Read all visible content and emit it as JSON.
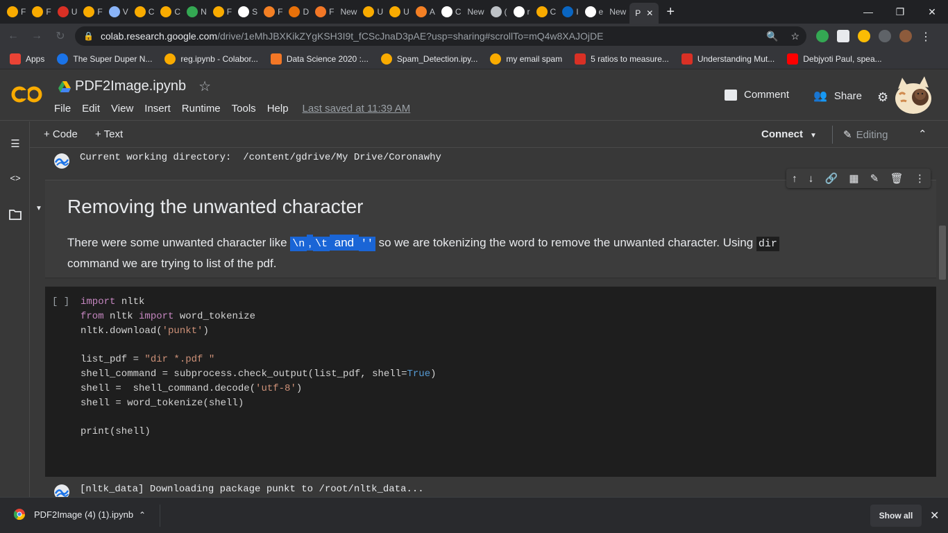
{
  "browser": {
    "tabs": [
      {
        "label": "F",
        "icon": "colab-icon",
        "color": "#f9ab00"
      },
      {
        "label": "F",
        "icon": "colab-icon",
        "color": "#f9ab00"
      },
      {
        "label": "U",
        "icon": "as-icon",
        "color": "#d93025"
      },
      {
        "label": "F",
        "icon": "colab-icon",
        "color": "#f9ab00"
      },
      {
        "label": "V",
        "icon": "shield-icon",
        "color": "#8ab4f8"
      },
      {
        "label": "C",
        "icon": "colab-icon",
        "color": "#f9ab00"
      },
      {
        "label": "C",
        "icon": "colab-icon",
        "color": "#f9ab00"
      },
      {
        "label": "N",
        "icon": "drive-icon",
        "color": "#34a853"
      },
      {
        "label": "F",
        "icon": "colab-icon",
        "color": "#f9ab00"
      },
      {
        "label": "S",
        "icon": "google-icon",
        "color": "#ffffff"
      },
      {
        "label": "F",
        "icon": "stackoverflow-icon",
        "color": "#f48024"
      },
      {
        "label": "D",
        "icon": "loading-icon",
        "color": "#e8710a"
      },
      {
        "label": "F",
        "icon": "jupyter-icon",
        "color": "#f37726"
      },
      {
        "label": "New",
        "icon": "none",
        "color": "#202124"
      },
      {
        "label": "U",
        "icon": "colab-icon",
        "color": "#f9ab00"
      },
      {
        "label": "U",
        "icon": "colab-icon",
        "color": "#f9ab00"
      },
      {
        "label": "A",
        "icon": "stackoverflow-icon",
        "color": "#f48024"
      },
      {
        "label": "C",
        "icon": "google-icon",
        "color": "#ffffff"
      },
      {
        "label": "New",
        "icon": "none",
        "color": "#202124"
      },
      {
        "label": "(",
        "icon": "audio-icon",
        "color": "#bdc1c6"
      },
      {
        "label": "r",
        "icon": "github-icon",
        "color": "#ffffff"
      },
      {
        "label": "C",
        "icon": "colab-icon",
        "color": "#f9ab00"
      },
      {
        "label": "I",
        "icon": "linkedin-icon",
        "color": "#0a66c2"
      },
      {
        "label": "e",
        "icon": "github-icon",
        "color": "#ffffff"
      },
      {
        "label": "New",
        "icon": "none",
        "color": "#202124"
      }
    ],
    "active_tab_label": "P",
    "close_symbol": "✕",
    "new_tab_symbol": "+",
    "window_controls": [
      "—",
      "❐",
      "✕"
    ],
    "url_domain": "colab.research.google.com",
    "url_path": "/drive/1eMhJBXKikZYgKSH3I9t_fCScJnaD3pAE?usp=sharing#scrollTo=mQ4w8XAJOjDE"
  },
  "bookmarks": [
    {
      "label": "Apps",
      "icon": "apps-grid-icon",
      "color": "#ea4335"
    },
    {
      "label": "The Super Duper N...",
      "icon": "globe-icon",
      "color": "#1a73e8"
    },
    {
      "label": "reg.ipynb - Colabor...",
      "icon": "colab-icon",
      "color": "#f9ab00"
    },
    {
      "label": "Data Science 2020 :...",
      "icon": "jupyter-icon",
      "color": "#f37726"
    },
    {
      "label": "Spam_Detection.ipy...",
      "icon": "colab-icon",
      "color": "#f9ab00"
    },
    {
      "label": "my email spam",
      "icon": "colab-icon",
      "color": "#f9ab00"
    },
    {
      "label": "5 ratios to measure...",
      "icon": "m-icon",
      "color": "#d93025"
    },
    {
      "label": "Understanding Mut...",
      "icon": "medium-icon",
      "color": "#d93025"
    },
    {
      "label": "Debjyoti Paul, spea...",
      "icon": "youtube-icon",
      "color": "#ff0000"
    }
  ],
  "colab": {
    "logo": "CO",
    "title": "PDF2Image.ipynb",
    "menu": [
      "File",
      "Edit",
      "View",
      "Insert",
      "Runtime",
      "Tools",
      "Help"
    ],
    "last_saved": "Last saved at 11:39 AM",
    "comment_label": "Comment",
    "share_label": "Share"
  },
  "toolbar": {
    "add_code": "+ Code",
    "add_text": "+ Text",
    "connect": "Connect",
    "editing": "Editing"
  },
  "notebook": {
    "cwd_output": "Current working directory:  /content/gdrive/My Drive/Coronawhy",
    "heading": "Removing the unwanted character",
    "para_before": "There were some unwanted character like ",
    "sel_newline": "\\n",
    "sel_comma": ",",
    "sel_tab": "\\t",
    "sel_and": " and ",
    "sel_quotes": "''",
    "para_middle": " so we are tokenizing the word to remove the unwanted character. Using ",
    "inline_code": "dir",
    "para_after": "command we are trying to list of the pdf.",
    "run_brackets": "[ ]",
    "nltk_output": "[nltk_data] Downloading package punkt to /root/nltk_data..."
  },
  "download": {
    "filename": "PDF2Image (4) (1).ipynb",
    "show_all": "Show all"
  },
  "colors": {
    "accent_orange": "#f9ab00",
    "selection_blue": "#1a65d6",
    "keyword": "#c586c0",
    "string": "#ce9178",
    "boolean": "#569cd6"
  }
}
